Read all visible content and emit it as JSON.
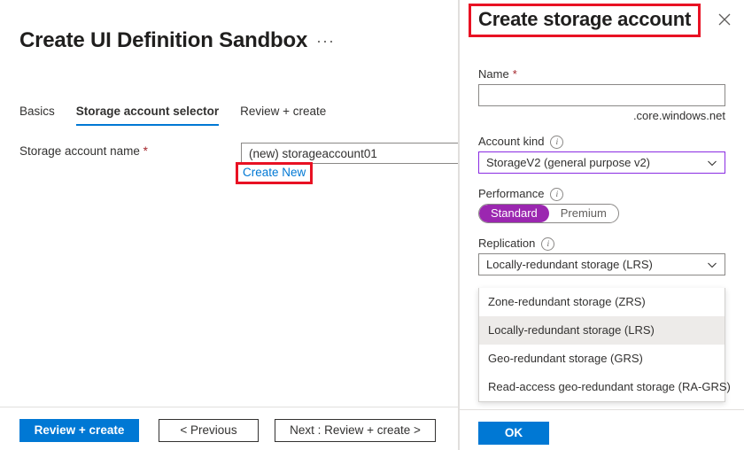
{
  "blade": {
    "title": "Create UI Definition Sandbox",
    "more_label": "···",
    "tabs": [
      {
        "label": "Basics",
        "active": false
      },
      {
        "label": "Storage account selector",
        "active": true
      },
      {
        "label": "Review + create",
        "active": false
      }
    ],
    "form": {
      "storage_account_name_label": "Storage account name",
      "required_marker": "*",
      "storage_account_name_value": "(new) storageaccount01",
      "storage_account_name_placeholder": "",
      "create_new_link": "Create New"
    },
    "footer": {
      "review_create_label": "Review + create",
      "previous_label": "< Previous",
      "next_label": "Next : Review + create >"
    }
  },
  "pane": {
    "title": "Create storage account",
    "close_icon": "close-icon",
    "fields": {
      "name_label": "Name",
      "name_required": "*",
      "name_value": "",
      "name_placeholder": "",
      "name_suffix": ".core.windows.net",
      "account_kind_label": "Account kind",
      "account_kind_info_icon": "info-icon",
      "account_kind_value": "StorageV2 (general purpose v2)",
      "performance_label": "Performance",
      "performance_info_icon": "info-icon",
      "performance_options": [
        {
          "label": "Standard",
          "selected": true
        },
        {
          "label": "Premium",
          "selected": false
        }
      ],
      "replication_label": "Replication",
      "replication_info_icon": "info-icon",
      "replication_value": "Locally-redundant storage (LRS)",
      "replication_options": [
        {
          "label": "Zone-redundant storage (ZRS)",
          "highlighted": false
        },
        {
          "label": "Locally-redundant storage (LRS)",
          "highlighted": true
        },
        {
          "label": "Geo-redundant storage (GRS)",
          "highlighted": false
        },
        {
          "label": "Read-access geo-redundant storage (RA-GRS)",
          "highlighted": false
        }
      ]
    },
    "footer": {
      "ok_label": "OK"
    }
  },
  "colors": {
    "accent_blue": "#0078d4",
    "annotation_red": "#e81123",
    "focus_purple": "#8a2be2",
    "toggle_purple": "#9b27b0",
    "required_red": "#a4262c",
    "link_blue": "#0078d4",
    "highlight_gray": "#edebe9",
    "border_gray": "#8a8886"
  }
}
